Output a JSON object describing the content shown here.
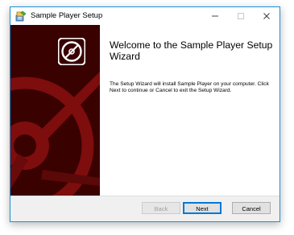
{
  "window": {
    "title": "Sample Player Setup"
  },
  "caption": {
    "minimize_icon": "minimize-icon",
    "maximize_icon": "maximize-icon",
    "close_icon": "close-icon"
  },
  "banner": {
    "logo_icon": "disc-icon",
    "colors": {
      "background": "#3a0101",
      "accent": "#7e0d0d"
    }
  },
  "content": {
    "heading": "Welcome to the Sample Player Setup Wizard",
    "body": "The Setup Wizard will install Sample Player on your computer. Click Next to continue or Cancel to exit the Setup Wizard."
  },
  "footer": {
    "back_label": "Back",
    "next_label": "Next",
    "cancel_label": "Cancel"
  },
  "colors": {
    "window_border": "#1e8fd6",
    "default_button_border": "#0078d7"
  }
}
